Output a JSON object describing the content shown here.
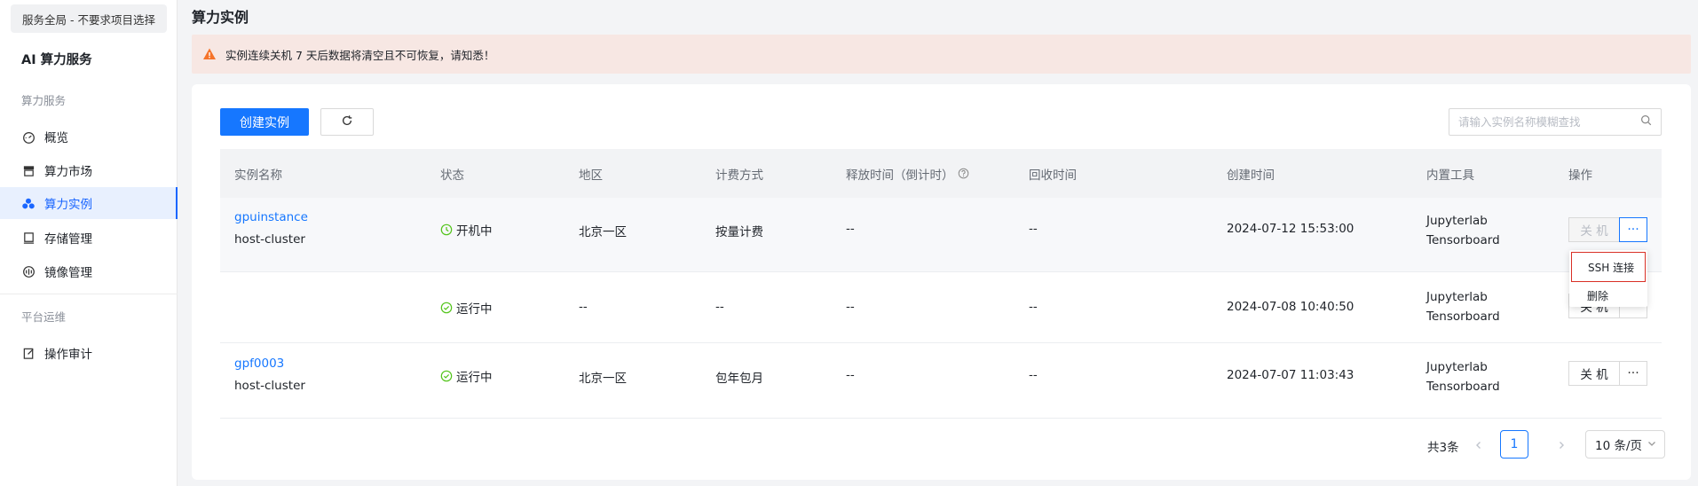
{
  "sidebar": {
    "scope_button": "服务全局 - 不要求项目选择",
    "app_title": "AI 算力服务",
    "group1_label": "算力服务",
    "group2_label": "平台运维",
    "items": [
      {
        "label": "概览",
        "icon": "dashboard-icon"
      },
      {
        "label": "算力市场",
        "icon": "market-icon"
      },
      {
        "label": "算力实例",
        "icon": "instances-icon"
      },
      {
        "label": "存储管理",
        "icon": "storage-icon"
      },
      {
        "label": "镜像管理",
        "icon": "image-icon"
      },
      {
        "label": "操作审计",
        "icon": "audit-icon"
      }
    ],
    "active_index": 2
  },
  "page": {
    "title": "算力实例",
    "alert": "实例连续关机 7 天后数据将清空且不可恢复，请知悉！"
  },
  "toolbar": {
    "create_label": "创建实例",
    "search_placeholder": "请输入实例名称模糊查找"
  },
  "table": {
    "columns": [
      "实例名称",
      "状态",
      "地区",
      "计费方式",
      "释放时间（倒计时）",
      "回收时间",
      "创建时间",
      "内置工具",
      "操作"
    ],
    "rows": [
      {
        "name": "gpuinstance",
        "cluster": "host-cluster",
        "status": "开机中",
        "status_type": "starting",
        "region": "北京一区",
        "billing": "按量计费",
        "release": "--",
        "recycle": "--",
        "created": "2024-07-12 15:53:00",
        "tool1": "Jupyterlab",
        "tool2": "Tensorboard",
        "action": "关 机",
        "action_disabled": true
      },
      {
        "name": "",
        "cluster": "",
        "status": "运行中",
        "status_type": "running",
        "region": "--",
        "billing": "--",
        "release": "--",
        "recycle": "--",
        "created": "2024-07-08 10:40:50",
        "tool1": "Jupyterlab",
        "tool2": "Tensorboard",
        "action": "关 机",
        "action_disabled": false
      },
      {
        "name": "gpf0003",
        "cluster": "host-cluster",
        "status": "运行中",
        "status_type": "running",
        "region": "北京一区",
        "billing": "包年包月",
        "release": "--",
        "recycle": "--",
        "created": "2024-07-07 11:03:43",
        "tool1": "Jupyterlab",
        "tool2": "Tensorboard",
        "action": "关 机",
        "action_disabled": false
      }
    ],
    "more_label": "···"
  },
  "dropdown": {
    "items": [
      "SSH 连接",
      "删除"
    ]
  },
  "pagination": {
    "total": "共3条",
    "current": "1",
    "page_size": "10 条/页"
  },
  "colors": {
    "primary": "#1677ff",
    "success": "#52c41a",
    "warning": "#f5732a",
    "alert_bg": "#f7e7e3",
    "highlight_border": "#d93026"
  }
}
